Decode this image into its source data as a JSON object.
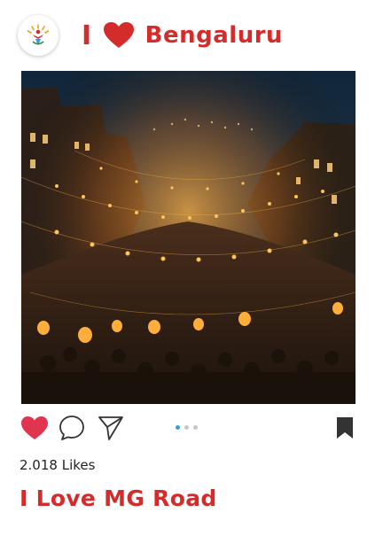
{
  "header": {
    "logo_icon": "bengaluru-emblem-icon",
    "brand_i": "I",
    "brand_heart_icon": "heart-icon",
    "brand_name": "Bengaluru"
  },
  "post": {
    "image": "night-street-lanterns-crowd",
    "likes": "2.018 Likes",
    "caption": "I Love MG Road",
    "carousel": {
      "count": 3,
      "active_index": 0
    }
  },
  "actions": {
    "like_icon": "heart-filled-icon",
    "comment_icon": "comment-bubble-icon",
    "share_icon": "send-icon",
    "save_icon": "bookmark-icon"
  },
  "colors": {
    "brand_red": "#d42b2b",
    "like_red": "#e0354f",
    "text_dark": "#222222",
    "dot_active": "#3a9bdc",
    "dot_inactive": "#c8c8c8"
  }
}
